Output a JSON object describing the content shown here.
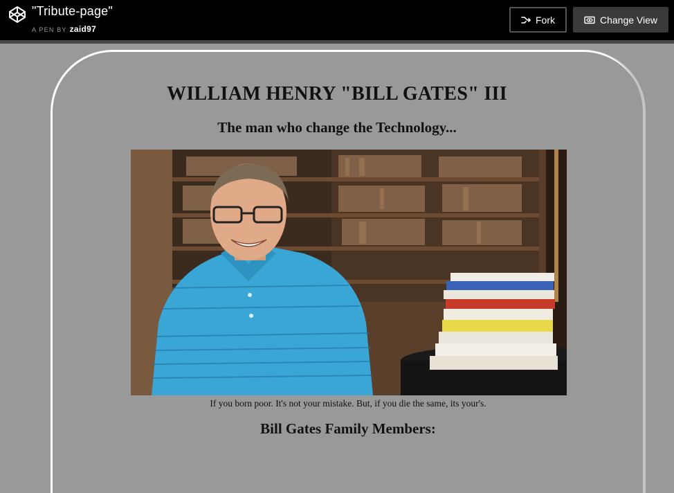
{
  "header": {
    "pen_title": "\"Tribute-page\"",
    "byline_prefix": "A PEN BY",
    "author": "zaid97",
    "fork_label": "Fork",
    "change_view_label": "Change View",
    "icons": {
      "logo": "codepen-logo-icon",
      "fork": "fork-icon",
      "change_view": "eye-icon"
    }
  },
  "tribute": {
    "title": "WILLIAM HENRY \"BILL GATES\" III",
    "subtitle": "The man who change the Technology...",
    "image_caption": "If you born poor. It's not your mistake. But, if you die the same, its your's.",
    "family_heading": "Bill Gates Family Members:"
  },
  "colors": {
    "header_bg": "#000000",
    "page_bg": "#999999",
    "frame_border": "#ffffff"
  }
}
